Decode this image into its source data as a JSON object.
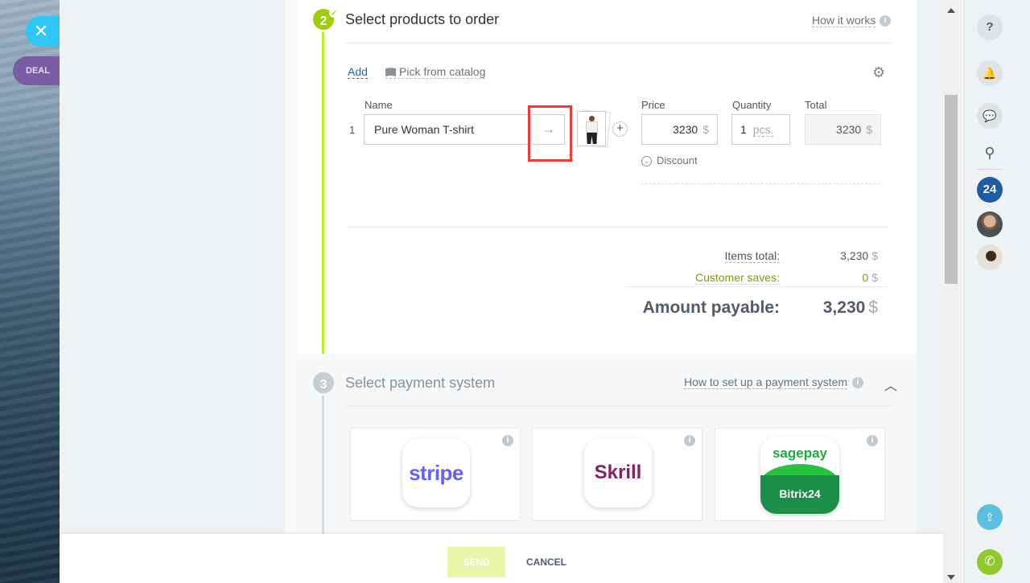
{
  "slider": {
    "close_icon": "close-icon",
    "badge": "DEAL"
  },
  "step2": {
    "number": "2",
    "title": "Select products to order",
    "help_link": "How it works",
    "toolbar": {
      "add": "Add",
      "pick_catalog": "Pick from catalog"
    },
    "columns": {
      "name": "Name",
      "price": "Price",
      "quantity": "Quantity",
      "total": "Total"
    },
    "row": {
      "index": "1",
      "name": "Pure Woman T-shirt",
      "price": "3230",
      "currency": "$",
      "quantity": "1",
      "unit": "pcs.",
      "total": "3230",
      "discount_label": "Discount"
    },
    "summary": {
      "items_total_label": "Items total:",
      "items_total_value": "3,230",
      "customer_saves_label": "Customer saves:",
      "customer_saves_value": "0",
      "amount_payable_label": "Amount payable:",
      "amount_payable_value": "3,230",
      "currency": "$"
    }
  },
  "step3": {
    "number": "3",
    "title": "Select payment system",
    "help_link": "How to set up a payment system",
    "payment_systems": [
      {
        "name": "stripe",
        "color": "#6461fc"
      },
      {
        "name": "Skrill",
        "color": "#862165"
      },
      {
        "name_top": "sagepay",
        "name_bottom": "Bitrix24",
        "color": "#1a8f4a"
      }
    ]
  },
  "footer": {
    "send": "SEND",
    "cancel": "CANCEL"
  },
  "right_sidebar": {
    "help": "?",
    "badge_24": "24",
    "icons": [
      "help-icon",
      "bell-icon",
      "chat-icon",
      "search-icon",
      "bitrix24-icon",
      "avatar",
      "avatar",
      "share-icon",
      "phone-icon"
    ]
  },
  "colors": {
    "accent_green": "#9dcf00",
    "link_blue": "#2067b0",
    "highlight_red": "#ef3b3b",
    "close_blue": "#2fc6f6"
  }
}
